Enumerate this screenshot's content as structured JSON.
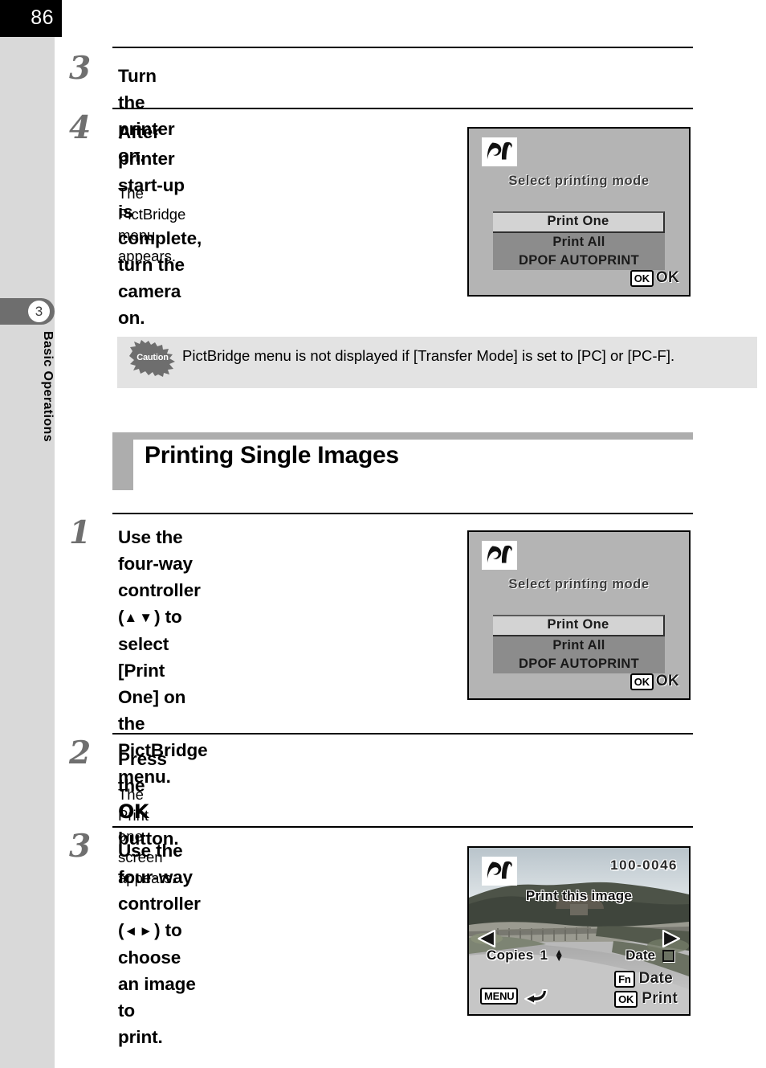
{
  "page": {
    "number": "86",
    "chapter_number": "3",
    "chapter_label": "Basic Operations"
  },
  "steps": [
    {
      "number": "3",
      "title": "Turn the printer on.",
      "body": ""
    },
    {
      "number": "4",
      "title_line1": "After printer start-up is",
      "title_line2": "complete, turn the camera on.",
      "body": "The PictBridge menu appears."
    },
    {
      "number": "1",
      "title_line1": "Use the four-way controller",
      "title_line2_pre": "(",
      "title_line2_arrows": "▲▼",
      "title_line2_post": ") to select [Print One] on",
      "title_line3": "the PictBridge menu.",
      "body": ""
    },
    {
      "number": "2",
      "title_pre": "Press the ",
      "title_key": "OK",
      "title_post": " button.",
      "body": "The Print one screen appears."
    },
    {
      "number": "3",
      "title_line1": "Use the four-way controller",
      "title_line2_pre": "(",
      "title_line2_arrows": "◄►",
      "title_line2_post": ") to choose an image to",
      "title_line3": "print.",
      "body": ""
    }
  ],
  "caution": {
    "icon_label": "Caution",
    "text": "PictBridge menu is not displayed if [Transfer Mode] is set to [PC] or [PC-F]."
  },
  "section": {
    "title": "Printing Single Images"
  },
  "lcd_menu": {
    "logo_name": "pictbridge-logo",
    "title": "Select printing mode",
    "items": [
      {
        "label": "Print One",
        "selected": true
      },
      {
        "label": "Print All",
        "selected": false
      },
      {
        "label": "DPOF AUTOPRINT",
        "selected": false
      }
    ],
    "confirm_key": "OK",
    "confirm_label": "OK"
  },
  "lcd_photo": {
    "logo_name": "pictbridge-logo",
    "file_number": "100-0046",
    "title": "Print this image",
    "left_arrow": "◀",
    "right_arrow": "▶",
    "copies_label": "Copies",
    "copies_value": "1",
    "spin_up": "▲",
    "spin_down": "▼",
    "date_label": "Date",
    "keys": [
      {
        "badge": "Fn",
        "label": "Date"
      },
      {
        "badge": "OK",
        "label": "Print"
      }
    ],
    "menu_badge": "MENU"
  },
  "colors": {
    "gutter": "#d9d9d9",
    "chapter_tab": "#6e6e6e",
    "section_rule": "#adadad",
    "caution_bg": "#e3e3e3",
    "lcd_bg": "#b4b4b4",
    "lcd_menu_bg": "#8c8c8c",
    "lcd_selected_bg": "#d3d3d3",
    "step_number": "#6f6f6f"
  }
}
